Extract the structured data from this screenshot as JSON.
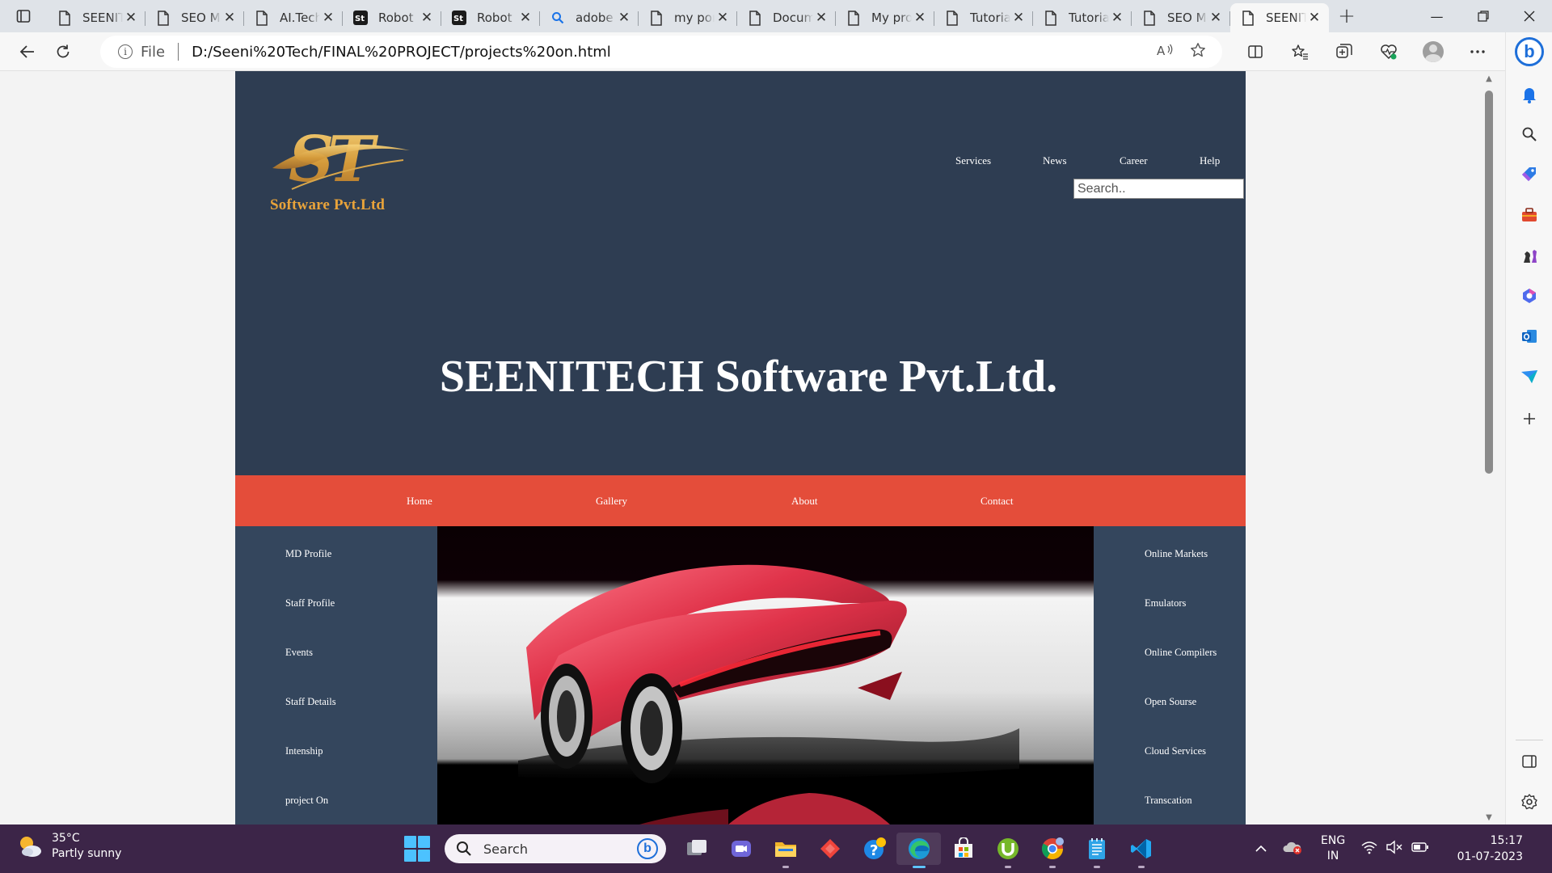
{
  "browser": {
    "tabs": [
      {
        "label": "SEENITECH",
        "icon": "page-icon"
      },
      {
        "label": "SEO Meta",
        "icon": "page-icon"
      },
      {
        "label": "AI.Tech",
        "icon": "page-icon"
      },
      {
        "label": "Robot",
        "icon": "st-logo-icon"
      },
      {
        "label": "Robot",
        "icon": "st-logo-icon"
      },
      {
        "label": "adobe",
        "icon": "search-icon"
      },
      {
        "label": "my portfolio",
        "icon": "page-icon"
      },
      {
        "label": "Document",
        "icon": "page-icon"
      },
      {
        "label": "My project",
        "icon": "page-icon"
      },
      {
        "label": "Tutorial",
        "icon": "page-icon"
      },
      {
        "label": "Tutorial",
        "icon": "page-icon"
      },
      {
        "label": "SEO Meta",
        "icon": "page-icon"
      },
      {
        "label": "SEENITECH",
        "icon": "page-icon",
        "active": true
      }
    ],
    "address": {
      "scheme_label": "File",
      "url": "D:/Seeni%20Tech/FINAL%20PROJECT/projects%20on.html"
    }
  },
  "site": {
    "logo_monogram": "ST",
    "logo_text": "Software Pvt.Ltd",
    "top_nav": [
      "Services",
      "News",
      "Career",
      "Help"
    ],
    "search_placeholder": "Search..",
    "hero_title": "SEENITECH Software Pvt.Ltd.",
    "main_nav": [
      "Home",
      "Gallery",
      "About",
      "Contact"
    ],
    "left_links": [
      "MD Profile",
      "Staff Profile",
      "Events",
      "Staff Details",
      "Intenship",
      "project On"
    ],
    "right_links": [
      "Online Markets",
      "Emulators",
      "Online Compilers",
      "Open Sourse",
      "Cloud Services",
      "Transcation"
    ],
    "colors": {
      "header_bg": "#2e3d52",
      "nav_bg": "#e44d3a",
      "content_bg": "#34465d",
      "logo_gold": "#e8a33a"
    }
  },
  "taskbar": {
    "weather_temp": "35°C",
    "weather_desc": "Partly sunny",
    "search_label": "Search",
    "lang_line1": "ENG",
    "lang_line2": "IN",
    "time": "15:17",
    "date": "01-07-2023"
  }
}
